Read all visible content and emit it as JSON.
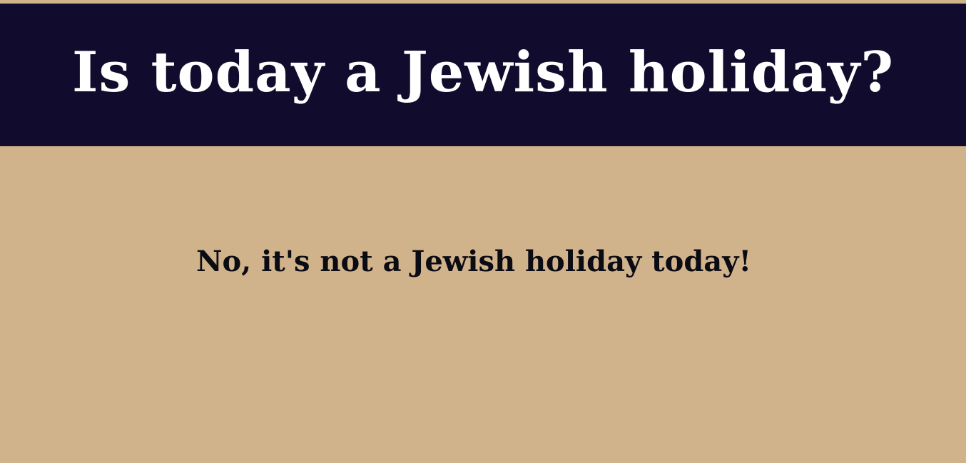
{
  "header": {
    "title": "Is today a Jewish holiday?"
  },
  "main": {
    "answer": "No, it's not a Jewish holiday today!"
  },
  "colors": {
    "background": "#d1b38b",
    "header_background": "#110b2d",
    "title_text": "#ffffff",
    "answer_text": "#0b0b14"
  }
}
